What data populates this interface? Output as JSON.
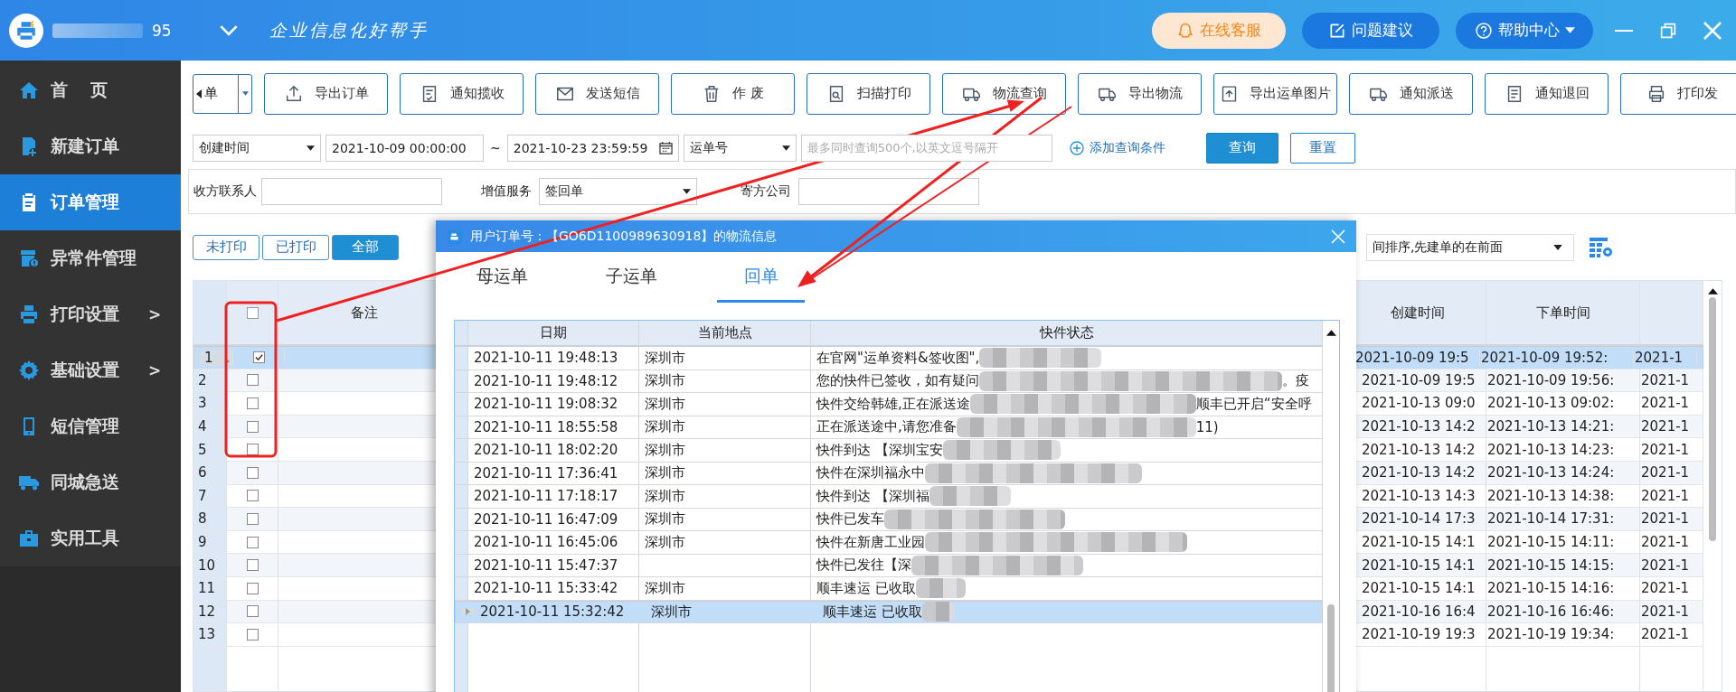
{
  "titlebar": {
    "account_suffix": "95",
    "slogan": "企业信息化好帮手",
    "buttons": [
      {
        "kind": "support",
        "label": "在线客服"
      },
      {
        "kind": "feedback",
        "label": "问题建议"
      },
      {
        "kind": "help",
        "label": "帮助中心"
      }
    ]
  },
  "sidebar": {
    "items": [
      {
        "label": "首 页",
        "selected": false
      },
      {
        "label": "新建订单",
        "selected": false
      },
      {
        "label": "订单管理",
        "selected": true
      },
      {
        "label": "异常件管理",
        "selected": false
      },
      {
        "label": "打印设置",
        "selected": false,
        "submenu_mark": ">"
      },
      {
        "label": "基础设置",
        "selected": false,
        "submenu_mark": ">"
      },
      {
        "label": "短信管理",
        "selected": false
      },
      {
        "label": "同城急送",
        "selected": false
      },
      {
        "label": "实用工具",
        "selected": false
      }
    ]
  },
  "toolbar": {
    "split_button": {
      "label": "单"
    },
    "buttons": [
      "导出订单",
      "通知揽收",
      "发送短信",
      "作 废",
      "扫描打印",
      "物流查询",
      "导出物流",
      "导出运单图片",
      "通知派送",
      "通知退回",
      "打印发"
    ]
  },
  "filters": {
    "date_field": "创建时间",
    "date_from": "2021-10-09 00:00:00",
    "range_separator": "~",
    "date_to": "2021-10-23 23:59:59",
    "search_field": "运单号",
    "search_placeholder": "最多同时查询500个,以英文逗号隔开",
    "add_condition": "添加查询条件",
    "query_button": "查询",
    "reset_button": "重置",
    "receiver_contact_label": "收方联系人",
    "value_added_label": "增值服务",
    "value_added": "签回单",
    "sender_company_label": "寄方公司"
  },
  "print_filter": [
    {
      "label": "未打印",
      "selected": false
    },
    {
      "label": "已打印",
      "selected": false
    },
    {
      "label": "全部",
      "selected": true
    }
  ],
  "sort": {
    "value": "间排序,先建单的在前面"
  },
  "table": {
    "header_checkbox": {
      "checked": false
    },
    "columns": [
      "备注",
      "创建时间",
      "下单时间"
    ],
    "rows": [
      {
        "number": "1",
        "checked": true,
        "selected": true,
        "created": "2021-10-09 19:5",
        "ordered": "2021-10-09 19:52:",
        "column_6": "2021-1"
      },
      {
        "number": "2",
        "checked": false,
        "selected": false,
        "created": "2021-10-09 19:5",
        "ordered": "2021-10-09 19:56:",
        "column_6": "2021-1"
      },
      {
        "number": "3",
        "checked": false,
        "selected": false,
        "created": "2021-10-13 09:0",
        "ordered": "2021-10-13 09:02:",
        "column_6": "2021-1"
      },
      {
        "number": "4",
        "checked": false,
        "selected": false,
        "created": "2021-10-13 14:2",
        "ordered": "2021-10-13 14:21:",
        "column_6": "2021-1"
      },
      {
        "number": "5",
        "checked": false,
        "selected": false,
        "created": "2021-10-13 14:2",
        "ordered": "2021-10-13 14:23:",
        "column_6": "2021-1"
      },
      {
        "number": "6",
        "checked": false,
        "selected": false,
        "created": "2021-10-13 14:2",
        "ordered": "2021-10-13 14:24:",
        "column_6": "2021-1"
      },
      {
        "number": "7",
        "checked": false,
        "selected": false,
        "created": "2021-10-13 14:3",
        "ordered": "2021-10-13 14:38:",
        "column_6": "2021-1"
      },
      {
        "number": "8",
        "checked": false,
        "selected": false,
        "created": "2021-10-14 17:3",
        "ordered": "2021-10-14 17:31:",
        "column_6": "2021-1"
      },
      {
        "number": "9",
        "checked": false,
        "selected": false,
        "created": "2021-10-15 14:1",
        "ordered": "2021-10-15 14:11:",
        "column_6": "2021-1"
      },
      {
        "number": "10",
        "checked": false,
        "selected": false,
        "created": "2021-10-15 14:1",
        "ordered": "2021-10-15 14:15:",
        "column_6": "2021-1"
      },
      {
        "number": "11",
        "checked": false,
        "selected": false,
        "created": "2021-10-15 14:1",
        "ordered": "2021-10-15 14:16:",
        "column_6": "2021-1"
      },
      {
        "number": "12",
        "checked": false,
        "selected": false,
        "created": "2021-10-16 16:4",
        "ordered": "2021-10-16 16:46:",
        "column_6": "2021-1"
      },
      {
        "number": "13",
        "checked": false,
        "selected": false,
        "created": "2021-10-19 19:3",
        "ordered": "2021-10-19 19:34:",
        "column_6": "2021-1"
      }
    ]
  },
  "dialog": {
    "title": "用户订单号：【GO6D1100989630918】的物流信息",
    "tabs": [
      {
        "label": "母运单",
        "selected": false
      },
      {
        "label": "子运单",
        "selected": false
      },
      {
        "label": "回单",
        "selected": true
      }
    ],
    "columns": [
      "日期",
      "当前地点",
      "快件状态"
    ],
    "rows": [
      {
        "date": "2021-10-11 19:48:13",
        "place": "深圳市",
        "status": "在官网\"运单资料&签收图\",",
        "selected": false
      },
      {
        "date": "2021-10-11 19:48:12",
        "place": "深圳市",
        "status": "您的快件已签收，如有疑问",
        "status_tail": "。疫",
        "selected": false
      },
      {
        "date": "2021-10-11 19:08:32",
        "place": "深圳市",
        "status": "快件交给韩雄,正在派送途",
        "status_tail": "顺丰已开启“安全呼",
        "selected": false
      },
      {
        "date": "2021-10-11 18:55:58",
        "place": "深圳市",
        "status": "正在派送途中,请您准备",
        "status_tail": "11)",
        "selected": false
      },
      {
        "date": "2021-10-11 18:02:20",
        "place": "深圳市",
        "status": "快件到达 【深圳宝安",
        "selected": false
      },
      {
        "date": "2021-10-11 17:36:41",
        "place": "深圳市",
        "status": "快件在深圳福永中",
        "selected": false
      },
      {
        "date": "2021-10-11 17:18:17",
        "place": "深圳市",
        "status": "快件到达 【深圳福",
        "selected": false
      },
      {
        "date": "2021-10-11 16:47:09",
        "place": "深圳市",
        "status": "快件已发车",
        "selected": false
      },
      {
        "date": "2021-10-11 16:45:06",
        "place": "深圳市",
        "status": "快件在新唐工业园",
        "selected": false
      },
      {
        "date": "2021-10-11 15:47:37",
        "status": "快件已发往【深",
        "selected": false
      },
      {
        "date": "2021-10-11 15:33:42",
        "place": "深圳市",
        "status": "顺丰速运 已收取",
        "selected": false
      },
      {
        "date": "2021-10-11 15:32:42",
        "place": "深圳市",
        "status": "顺丰速运 已收取",
        "selected": true
      }
    ]
  }
}
